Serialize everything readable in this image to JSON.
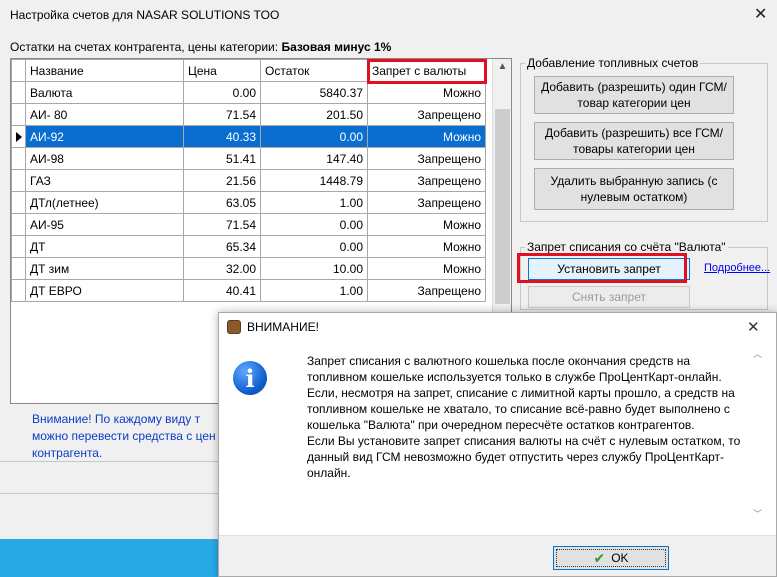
{
  "window": {
    "title": "Настройка счетов для NASAR SOLUTIONS TOO",
    "subtitle_prefix": "Остатки на счетах контрагента, цены категории:",
    "subtitle_category": "Базовая минус 1%"
  },
  "grid": {
    "columns": [
      "Название",
      "Цена",
      "Остаток",
      "Запрет с валюты"
    ],
    "rows": [
      {
        "name": "Валюта",
        "price": "0.00",
        "rest": "5840.37",
        "ban": "Можно"
      },
      {
        "name": "АИ- 80",
        "price": "71.54",
        "rest": "201.50",
        "ban": "Запрещено"
      },
      {
        "name": "АИ-92",
        "price": "40.33",
        "rest": "0.00",
        "ban": "Можно"
      },
      {
        "name": "АИ-98",
        "price": "51.41",
        "rest": "147.40",
        "ban": "Запрещено"
      },
      {
        "name": "ГАЗ",
        "price": "21.56",
        "rest": "1448.79",
        "ban": "Запрещено"
      },
      {
        "name": "ДТл(летнее)",
        "price": "63.05",
        "rest": "1.00",
        "ban": "Запрещено"
      },
      {
        "name": "АИ-95",
        "price": "71.54",
        "rest": "0.00",
        "ban": "Можно"
      },
      {
        "name": "ДТ",
        "price": "65.34",
        "rest": "0.00",
        "ban": "Можно"
      },
      {
        "name": "ДТ зим",
        "price": "32.00",
        "rest": "10.00",
        "ban": "Можно"
      },
      {
        "name": "ДТ ЕВРО",
        "price": "40.41",
        "rest": "1.00",
        "ban": "Запрещено"
      }
    ],
    "selected_row": 2
  },
  "add_group": {
    "legend": "Добавление топливных счетов",
    "add_one": "Добавить (разрешить) один ГСМ/товар категории цен",
    "add_all": "Добавить (разрешить) все ГСМ/товары категории цен",
    "delete": "Удалить выбранную запись (с нулевым остатком)"
  },
  "ban_group": {
    "legend": "Запрет списания со счёта \"Валюта\"",
    "set_ban": "Установить запрет",
    "remove_ban": "Снять запрет",
    "more_link": "Подробнее..."
  },
  "note": {
    "text": "Внимание! По каждому виду т можно перевести средства с цен контрагента."
  },
  "dialog": {
    "title": "ВНИМАНИЕ!",
    "text": "Запрет списания с валютного кошелька после окончания средств на топливном кошельке используется только в службе ПроЦентКарт-онлайн. Если, несмотря на запрет, списание с лимитной карты прошло, а средств на топливном кошельке не хватало, то списание всё-равно будет выполнено с кошелька \"Валюта\" при очередном пересчёте остатков контрагентов.\nЕсли Вы установите запрет списания валюты на счёт с нулевым остатком, то данный вид ГСМ невозможно будет отпустить через службу ПроЦентКарт-онлайн.",
    "ok_label": "OK"
  },
  "colors": {
    "highlight_red": "#e01020",
    "selection_blue": "#0a6ed1",
    "note_blue": "#0b3cc5",
    "taskbar_blue": "#28a9e6"
  }
}
